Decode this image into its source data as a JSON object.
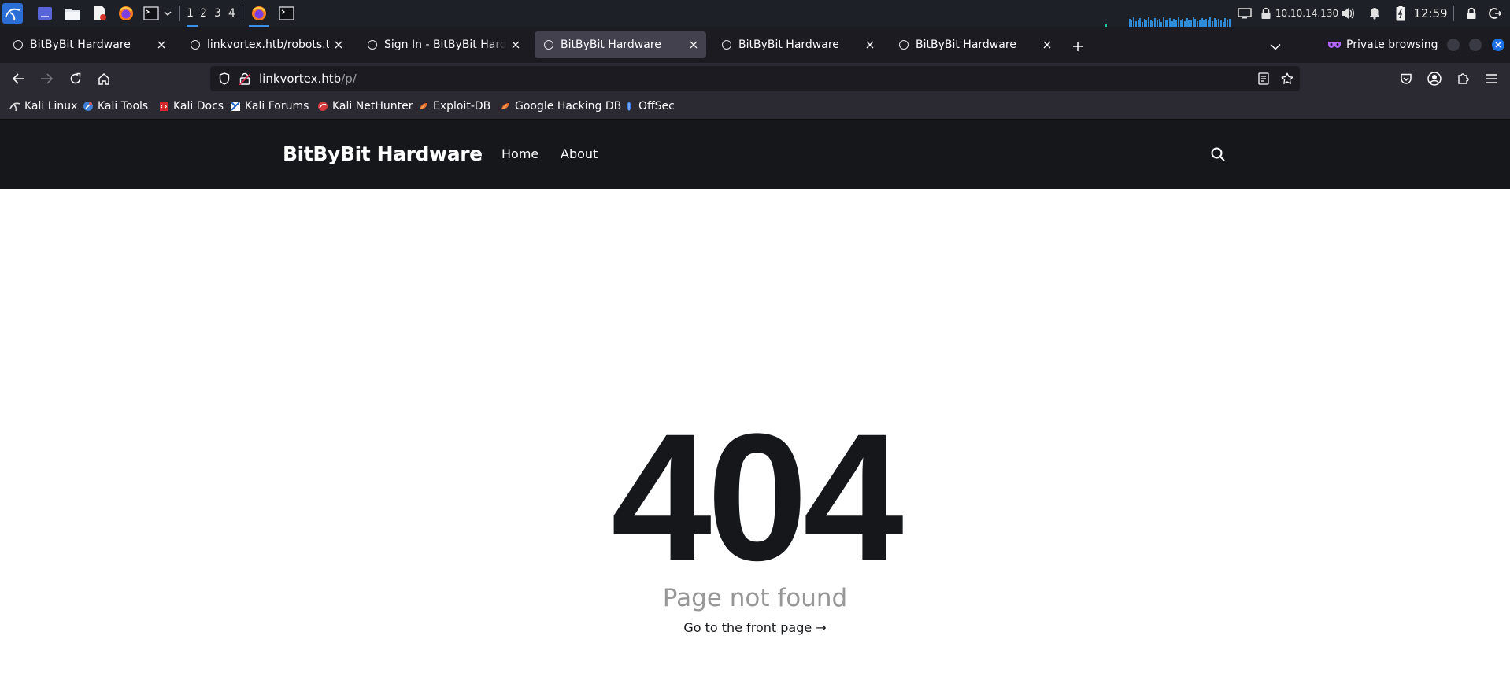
{
  "taskbar": {
    "workspaces": [
      "1",
      "2",
      "3",
      "4"
    ],
    "ip_address": "10.10.14.130",
    "clock": "12:59"
  },
  "browser": {
    "tabs": [
      {
        "title": "BitByBit Hardware",
        "active": false
      },
      {
        "title": "linkvortex.htb/robots.txt",
        "active": false
      },
      {
        "title": "Sign In - BitByBit Hardware",
        "active": false
      },
      {
        "title": "BitByBit Hardware",
        "active": true
      },
      {
        "title": "BitByBit Hardware",
        "active": false
      },
      {
        "title": "BitByBit Hardware",
        "active": false
      }
    ],
    "private_label": "Private browsing",
    "url_host": "linkvortex.htb",
    "url_path": "/p/",
    "bookmarks": [
      "Kali Linux",
      "Kali Tools",
      "Kali Docs",
      "Kali Forums",
      "Kali NetHunter",
      "Exploit-DB",
      "Google Hacking DB",
      "OffSec"
    ]
  },
  "site": {
    "title": "BitByBit Hardware",
    "nav": [
      "Home",
      "About"
    ]
  },
  "error": {
    "code": "404",
    "message": "Page not found",
    "link": "Go to the front page →"
  },
  "colors": {
    "taskbar_bg": "#1e2027",
    "tabstrip_bg": "#1c1b22",
    "toolbar_bg": "#2b2a33",
    "active_tab_bg": "#42414d",
    "site_header_bg": "#15171a",
    "error_code": "#15171a",
    "error_message": "#979797",
    "accent": "#3a8fe8"
  }
}
